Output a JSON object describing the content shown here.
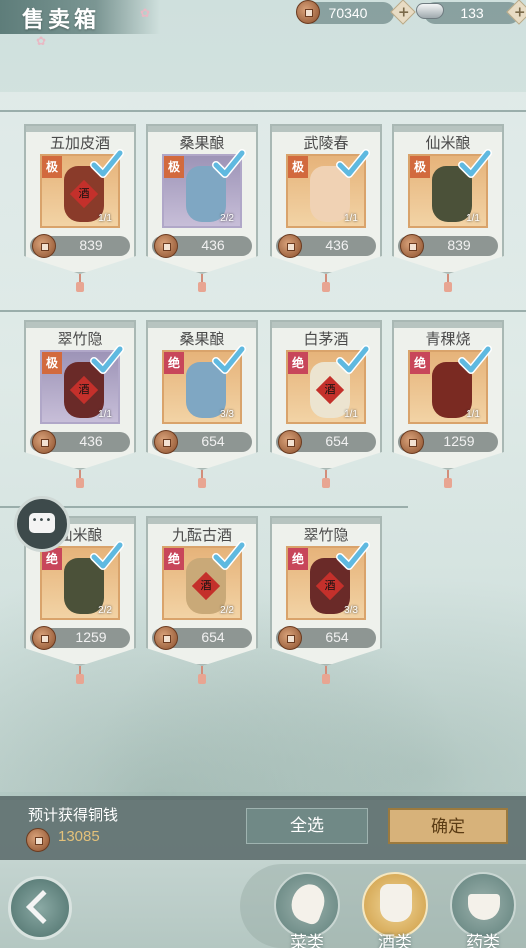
{
  "header": {
    "title": "售卖箱",
    "copper": "70340",
    "silver": "133"
  },
  "rows": [
    [
      {
        "name": "五加皮酒",
        "grade": "极",
        "grade_type": "ji",
        "qty": "1/1",
        "price": "839",
        "pic": "gold",
        "jar_color": "#8a3b2a",
        "label": "酒"
      },
      {
        "name": "桑果酿",
        "grade": "极",
        "grade_type": "ji",
        "qty": "2/2",
        "price": "436",
        "pic": "purple",
        "jar_color": "#7fa7c3",
        "label": ""
      },
      {
        "name": "武陵春",
        "grade": "极",
        "grade_type": "ji",
        "qty": "1/1",
        "price": "436",
        "pic": "gold",
        "jar_color": "#f0d2b4",
        "label": ""
      },
      {
        "name": "仙米酿",
        "grade": "极",
        "grade_type": "ji",
        "qty": "1/1",
        "price": "839",
        "pic": "gold",
        "jar_color": "#4b5139",
        "label": ""
      }
    ],
    [
      {
        "name": "翠竹隐",
        "grade": "极",
        "grade_type": "ji",
        "qty": "1/1",
        "price": "436",
        "pic": "purple",
        "jar_color": "#6a2a28",
        "label": "酒"
      },
      {
        "name": "桑果酿",
        "grade": "绝",
        "grade_type": "jue",
        "qty": "3/3",
        "price": "654",
        "pic": "gold",
        "jar_color": "#7fa7c3",
        "label": ""
      },
      {
        "name": "白茅酒",
        "grade": "绝",
        "grade_type": "jue",
        "qty": "1/1",
        "price": "654",
        "pic": "gold",
        "jar_color": "#ece4d0",
        "label": "酒"
      },
      {
        "name": "青稞烧",
        "grade": "绝",
        "grade_type": "jue",
        "qty": "1/1",
        "price": "1259",
        "pic": "gold",
        "jar_color": "#7a2a22",
        "label": ""
      }
    ],
    [
      {
        "name": "仙米酿",
        "grade": "绝",
        "grade_type": "jue",
        "qty": "2/2",
        "price": "1259",
        "pic": "gold",
        "jar_color": "#4b5139",
        "label": ""
      },
      {
        "name": "九酝古酒",
        "grade": "绝",
        "grade_type": "jue",
        "qty": "2/2",
        "price": "654",
        "pic": "gold",
        "jar_color": "#c9a978",
        "label": "酒"
      },
      {
        "name": "翠竹隐",
        "grade": "绝",
        "grade_type": "jue",
        "qty": "3/3",
        "price": "654",
        "pic": "gold",
        "jar_color": "#6a2a28",
        "label": "酒"
      }
    ]
  ],
  "footer": {
    "estimate_label": "预计获得铜钱",
    "estimate_total": "13085",
    "select_all": "全选",
    "confirm": "确定"
  },
  "categories": [
    {
      "label": "菜类",
      "active": false
    },
    {
      "label": "酒类",
      "active": true
    },
    {
      "label": "药类",
      "active": false
    }
  ],
  "colors": {
    "check": "#5fb9e0",
    "confirm_bg": "#d7b27a"
  }
}
